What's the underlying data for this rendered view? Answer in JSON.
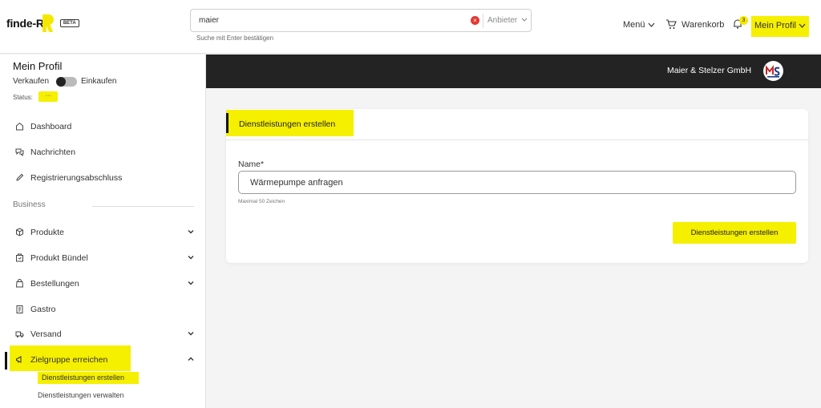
{
  "header": {
    "logo_text": "finde-R",
    "beta_label": "BETA",
    "search_value": "maier",
    "search_filter_label": "Anbieter",
    "search_hint": "Suche mit Enter bestätigen",
    "menu_label": "Menü",
    "cart_label": "Warenkorb",
    "notification_count": "3",
    "profile_label": "Mein Profil"
  },
  "sidebar": {
    "title": "Mein Profil",
    "sell_label": "Verkaufen",
    "buy_label": "Einkaufen",
    "status_label": "Status:",
    "status_value": "···",
    "items_top": [
      {
        "label": "Dashboard",
        "icon": "home-icon"
      },
      {
        "label": "Nachrichten",
        "icon": "messages-icon"
      },
      {
        "label": "Registrierungsabschluss",
        "icon": "pencil-icon"
      }
    ],
    "section_label": "Business",
    "items_business": [
      {
        "label": "Produkte",
        "icon": "box-icon",
        "expandable": true
      },
      {
        "label": "Produkt Bündel",
        "icon": "bundle-icon",
        "expandable": true
      },
      {
        "label": "Bestellungen",
        "icon": "bag-icon",
        "expandable": true
      },
      {
        "label": "Gastro",
        "icon": "clipboard-icon",
        "expandable": false
      },
      {
        "label": "Versand",
        "icon": "truck-icon",
        "expandable": true
      },
      {
        "label": "Zielgruppe erreichen",
        "icon": "megaphone-icon",
        "expandable": true,
        "active": true
      }
    ],
    "sub_items": [
      {
        "label": "Dienstleistungen erstellen",
        "active": true
      },
      {
        "label": "Dienstleistungen verwalten",
        "active": false
      }
    ]
  },
  "company": {
    "name": "Maier & Stelzer GmbH"
  },
  "card": {
    "title": "Dienstleistungen erstellen",
    "name_label": "Name*",
    "name_value": "Wärmepumpe anfragen",
    "name_hint": "Maximal 50 Zeichen",
    "submit_label": "Dienstleistungen erstellen"
  },
  "colors": {
    "accent": "#f5ef00",
    "dark_bar": "#232323"
  }
}
